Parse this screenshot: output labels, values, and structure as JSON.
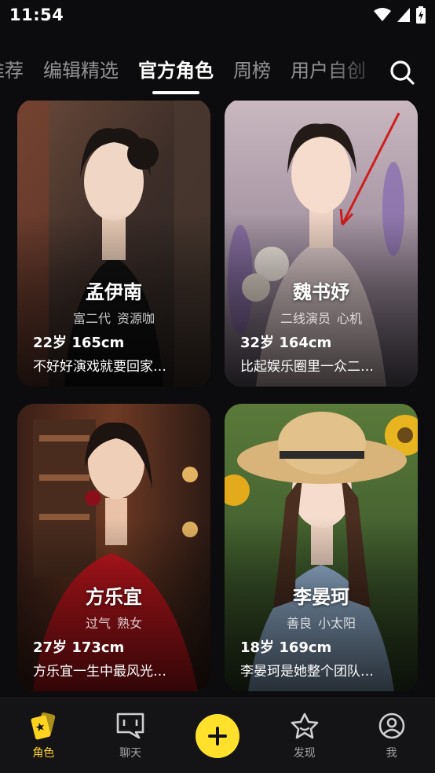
{
  "status_bar": {
    "time": "11:54"
  },
  "top_tabs": {
    "items": [
      "推荐",
      "编辑精选",
      "官方角色",
      "周榜",
      "用户自创"
    ],
    "active_index": 2
  },
  "cards": [
    {
      "name": "孟伊南",
      "tags": [
        "富二代",
        "资源咖"
      ],
      "stats": "22岁 165cm",
      "desc": "不好好演戏就要回家…"
    },
    {
      "name": "魏书妤",
      "tags": [
        "二线演员",
        "心机"
      ],
      "stats": "32岁 164cm",
      "desc": "比起娱乐圈里一众二…"
    },
    {
      "name": "方乐宜",
      "tags": [
        "过气",
        "熟女"
      ],
      "stats": "27岁 173cm",
      "desc": "方乐宜一生中最风光…"
    },
    {
      "name": "李晏珂",
      "tags": [
        "善良",
        "小太阳"
      ],
      "stats": "18岁 169cm",
      "desc": "李晏珂是她整个团队…"
    }
  ],
  "bottom_nav": {
    "items": [
      {
        "label": "角色",
        "icon": "cards-icon",
        "active": true
      },
      {
        "label": "聊天",
        "icon": "chat-icon",
        "active": false
      },
      {
        "label": "",
        "icon": "plus-icon",
        "active": false
      },
      {
        "label": "发现",
        "icon": "star-icon",
        "active": false
      },
      {
        "label": "我",
        "icon": "user-icon",
        "active": false
      }
    ]
  },
  "colors": {
    "accent": "#ffe12b",
    "active_label": "#ffd21f",
    "background": "#0c0c0e"
  }
}
